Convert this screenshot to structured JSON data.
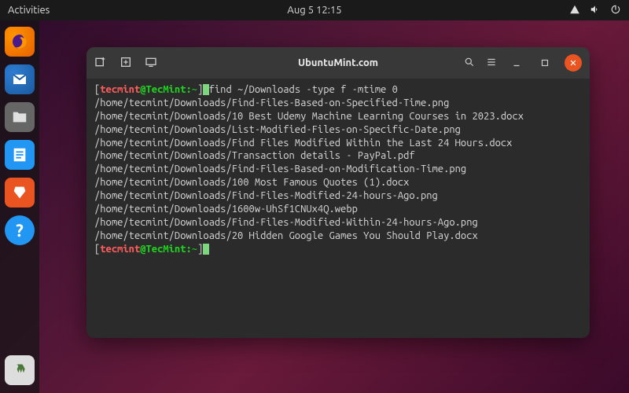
{
  "topbar": {
    "activities": "Activities",
    "datetime": "Aug 5  12:15"
  },
  "terminal": {
    "title": "UbuntuMint.com",
    "prompt": {
      "user": "tecmint",
      "at": "@",
      "host": "TecMint",
      "sep": ":",
      "path": "~",
      "end": "]"
    },
    "command": "find ~/Downloads -type f -mtime 0",
    "output": [
      "/home/tecmint/Downloads/Find-Files-Based-on-Specified-Time.png",
      "/home/tecmint/Downloads/10 Best Udemy Machine Learning Courses in 2023.docx",
      "/home/tecmint/Downloads/List-Modified-Files-on-Specific-Date.png",
      "/home/tecmint/Downloads/Find Files Modified Within the Last 24 Hours.docx",
      "/home/tecmint/Downloads/Transaction details - PayPal.pdf",
      "/home/tecmint/Downloads/Find-Files-Based-on-Modification-Time.png",
      "/home/tecmint/Downloads/100 Most Famous Quotes (1).docx",
      "/home/tecmint/Downloads/Find-Files-Modified-24-hours-Ago.png",
      "/home/tecmint/Downloads/1600w-UhSf1CNUx4Q.webp",
      "/home/tecmint/Downloads/Find-Files-Modified-Within-24-hours-Ago.png",
      "/home/tecmint/Downloads/20 Hidden Google Games You Should Play.docx"
    ]
  }
}
